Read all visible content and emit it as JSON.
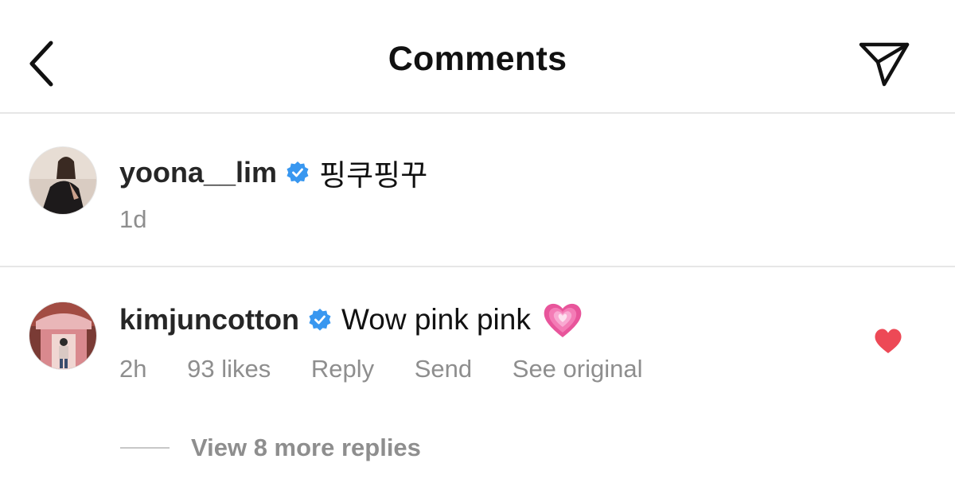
{
  "header": {
    "back_icon": "chevron-left-icon",
    "title": "Comments",
    "share_icon": "paper-plane-icon"
  },
  "caption": {
    "username": "yoona__lim",
    "verified": true,
    "text": "핑쿠핑꾸",
    "time": "1d"
  },
  "comments": [
    {
      "username": "kimjuncotton",
      "verified": true,
      "text": "Wow pink pink",
      "emoji": "💗",
      "time": "2h",
      "likes": "93 likes",
      "reply_label": "Reply",
      "send_label": "Send",
      "translate_label": "See original",
      "liked": true,
      "view_replies_label": "View 8 more replies"
    }
  ],
  "colors": {
    "verified_blue": "#3897f0",
    "like_red": "#ed4956",
    "secondary_text": "#8e8e8e",
    "divider": "#e6e6e6"
  }
}
